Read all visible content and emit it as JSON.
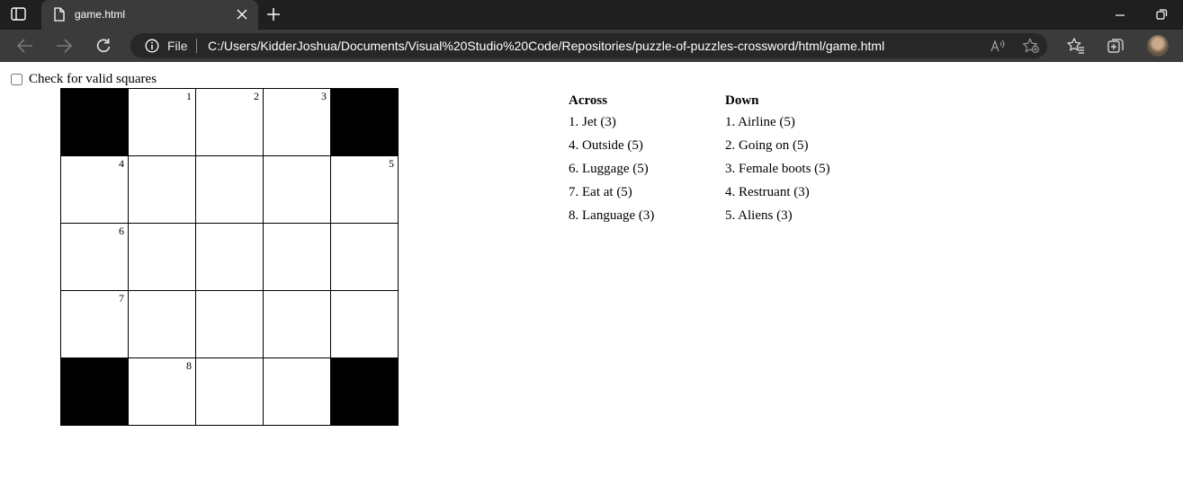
{
  "browser": {
    "tab_title": "game.html",
    "address": {
      "scheme": "File",
      "url": "C:/Users/KidderJoshua/Documents/Visual%20Studio%20Code/Repositories/puzzle-of-puzzles-crossword/html/game.html"
    },
    "icons": [
      "tab-actions-icon",
      "page-icon",
      "close-icon",
      "plus-icon",
      "minimize-icon",
      "restore-icon",
      "back-icon",
      "forward-icon",
      "refresh-icon",
      "info-icon",
      "read-aloud-icon",
      "add-favorite-icon",
      "favorites-icon",
      "collections-icon"
    ]
  },
  "page": {
    "checkbox_label": "Check for valid squares",
    "checkbox_checked": false
  },
  "crossword": {
    "rows": [
      [
        {
          "block": true
        },
        {
          "num": "1"
        },
        {
          "num": "2"
        },
        {
          "num": "3"
        },
        {
          "block": true
        }
      ],
      [
        {
          "num": "4"
        },
        {},
        {},
        {},
        {
          "num": "5"
        }
      ],
      [
        {
          "num": "6"
        },
        {},
        {},
        {},
        {}
      ],
      [
        {
          "num": "7"
        },
        {},
        {},
        {},
        {}
      ],
      [
        {
          "block": true
        },
        {
          "num": "8"
        },
        {},
        {},
        {
          "block": true
        }
      ]
    ]
  },
  "clues": {
    "across": {
      "heading": "Across",
      "items": [
        "1. Jet (3)",
        "4. Outside (5)",
        "6. Luggage (5)",
        "7. Eat at (5)",
        "8. Language (3)"
      ]
    },
    "down": {
      "heading": "Down",
      "items": [
        "1. Airline (5)",
        "2. Going on (5)",
        "3. Female boots (5)",
        "4. Restruant (3)",
        "5. Aliens (3)"
      ]
    }
  }
}
